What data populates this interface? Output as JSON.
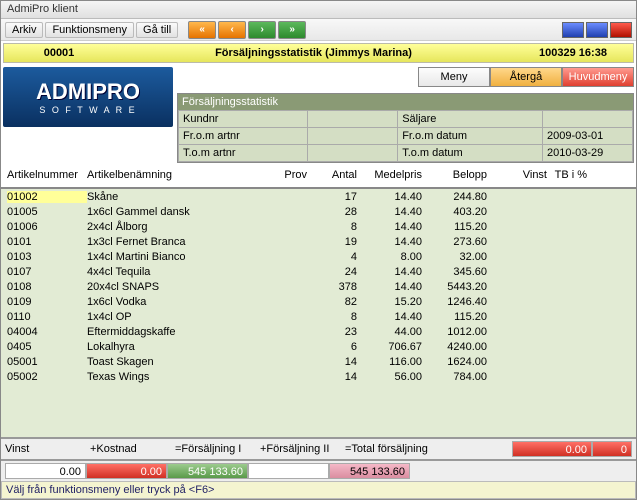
{
  "window": {
    "title": "AdmiPro klient"
  },
  "menu": {
    "arkiv": "Arkiv",
    "funk": "Funktionsmeny",
    "gatill": "Gå till"
  },
  "header": {
    "code": "00001",
    "title": "Försäljningsstatistik (Jimmys Marina)",
    "datetime": "100329 16:38"
  },
  "logo": {
    "main": "ADMIPRO",
    "sub": "S O F T W A R E"
  },
  "buttons": {
    "meny": "Meny",
    "aterga": "Återgå",
    "huvud": "Huvudmeny"
  },
  "filter": {
    "title": "Försäljningsstatistik",
    "l1": "Kundnr",
    "l2": "Fr.o.m artnr",
    "l3": "T.o.m artnr",
    "r1": "Säljare",
    "r2": "Fr.o.m datum",
    "r3": "T.o.m datum",
    "v2": "2009-03-01",
    "v3": "2010-03-29"
  },
  "cols": {
    "art": "Artikelnummer",
    "name": "Artikelbenämning",
    "prov": "Prov",
    "antal": "Antal",
    "medel": "Medelpris",
    "belopp": "Belopp",
    "vinst": "Vinst",
    "tb": "TB i %"
  },
  "rows": [
    {
      "art": "01002",
      "name": "Skåne",
      "antal": "17",
      "medel": "14.40",
      "belopp": "244.80"
    },
    {
      "art": "01005",
      "name": "1x6cl Gammel dansk",
      "antal": "28",
      "medel": "14.40",
      "belopp": "403.20"
    },
    {
      "art": "01006",
      "name": "2x4cl Ålborg",
      "antal": "8",
      "medel": "14.40",
      "belopp": "115.20"
    },
    {
      "art": "0101",
      "name": "1x3cl Fernet  Branca",
      "antal": "19",
      "medel": "14.40",
      "belopp": "273.60"
    },
    {
      "art": "0103",
      "name": "1x4cl Martini Bianco",
      "antal": "4",
      "medel": "8.00",
      "belopp": "32.00"
    },
    {
      "art": "0107",
      "name": "4x4cl Tequila",
      "antal": "24",
      "medel": "14.40",
      "belopp": "345.60"
    },
    {
      "art": "0108",
      "name": "20x4cl SNAPS",
      "antal": "378",
      "medel": "14.40",
      "belopp": "5443.20"
    },
    {
      "art": "0109",
      "name": "1x6cl Vodka",
      "antal": "82",
      "medel": "15.20",
      "belopp": "1246.40"
    },
    {
      "art": "0110",
      "name": "1x4cl OP",
      "antal": "8",
      "medel": "14.40",
      "belopp": "115.20"
    },
    {
      "art": "04004",
      "name": "Eftermiddagskaffe",
      "antal": "23",
      "medel": "44.00",
      "belopp": "1012.00"
    },
    {
      "art": "0405",
      "name": "Lokalhyra",
      "antal": "6",
      "medel": "706.67",
      "belopp": "4240.00"
    },
    {
      "art": "05001",
      "name": "Toast Skagen",
      "antal": "14",
      "medel": "116.00",
      "belopp": "1624.00"
    },
    {
      "art": "05002",
      "name": "Texas Wings",
      "antal": "14",
      "medel": "56.00",
      "belopp": "784.00"
    }
  ],
  "sum": {
    "vinst": "Vinst",
    "kostnad": "+Kostnad",
    "f1": "=Försäljning I",
    "f2": "+Försäljning II",
    "tot": "=Total försäljning",
    "b1": "0.00",
    "b2": "0",
    "c1": "0.00",
    "c2": "0.00",
    "c3": "545 133.60",
    "c4": "545 133.60"
  },
  "status": "Välj från funktionsmeny eller tryck på <F6>"
}
